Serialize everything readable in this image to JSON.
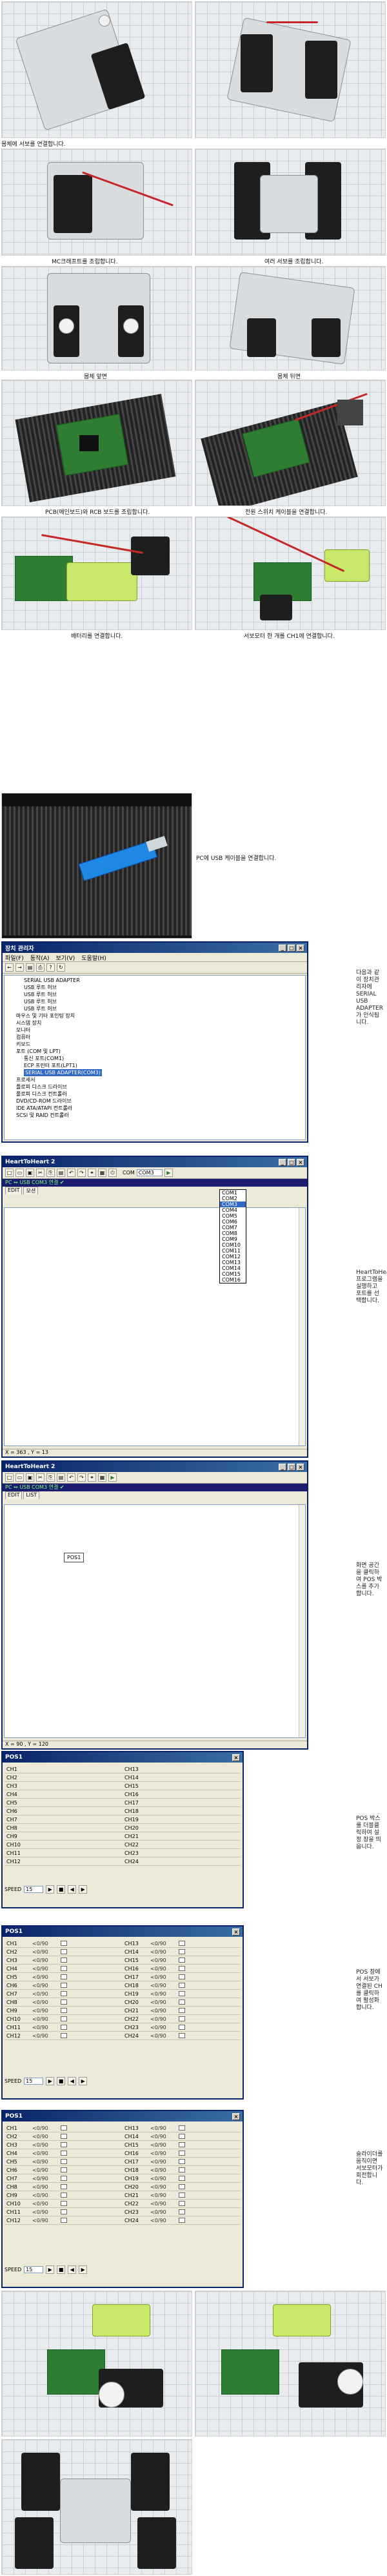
{
  "captions": {
    "p1": "몸체에 서보를 연결합니다.",
    "p2": "",
    "p3": "MC크래프트를 조립합니다.",
    "p4": "여러 서보를 조립합니다.",
    "p5": "몸체 앞면",
    "p6": "몸체 뒤면",
    "p7": "PCB(메인보드)와 RCB 보드를 조립합니다.",
    "p8": "전원 스위치 케이블을 연결합니다.",
    "p9": "배터리를 연결합니다.",
    "p10": "서보모터 한 개를 CH1에 연결합니다.",
    "p11": "PC에 USB 케이블을 연결합니다."
  },
  "device_manager": {
    "title": "장치 관리자",
    "menu": [
      "파일(F)",
      "동작(A)",
      "보기(V)",
      "도움말(H)"
    ],
    "tree": [
      "SERIAL USB ADAPTER",
      "USB 루트 허브",
      "USB 루트 허브",
      "USB 루트 허브",
      "USB 루트 허브",
      "마우스 및 기타 포인팅 장치",
      "시스템 장치",
      "모니터",
      "컴퓨터",
      "키보드",
      "포트 (COM 및 LPT)",
      "통신 포트(COM1)",
      "ECP 프린터 포트(LPT1)",
      "SERIAL USB ADAPTER(COM3)",
      "프로세서",
      "플로피 디스크 드라이브",
      "플로피 디스크 컨트롤러",
      "DVD/CD-ROM 드라이브",
      "IDE ATA/ATAPI 컨트롤러",
      "SCSI 및 RAID 컨트롤러"
    ],
    "selected_index": 13,
    "side_caption": "다음과 같이 장치관리자에 SERIAL USB ADAPTER가 인식됩니다."
  },
  "heart1": {
    "title": "HeartToHeart 2",
    "com_label": "COM",
    "com_value": "COM3",
    "com_options": [
      "COM1",
      "COM2",
      "COM3",
      "COM4",
      "COM5",
      "COM6",
      "COM7",
      "COM8",
      "COM9",
      "COM10",
      "COM11",
      "COM12",
      "COM13",
      "COM14",
      "COM15",
      "COM16"
    ],
    "status_line": "PC ↔ USB  COM3 연결 ✔",
    "tabs": [
      "EDIT",
      "모션"
    ],
    "statusbar": "X = 363 , Y = 13",
    "side_caption": "HeartToHeart 프로그램을 실행하고 포트를 선택합니다."
  },
  "heart2": {
    "title": "HeartToHeart 2",
    "status_line": "PC ↔ USB  COM3 연결 ✔",
    "tabs": [
      "EDIT",
      "LIST"
    ],
    "box_label": "POS1",
    "statusbar": "X = 90 , Y = 120",
    "side_caption": "화면 공간을 클릭하여 POS 박스를 추가합니다."
  },
  "pos_windows": [
    {
      "title": "POS1",
      "rows_left": [
        "CH1",
        "CH2",
        "CH3",
        "CH4",
        "CH5",
        "CH6",
        "CH7",
        "CH8",
        "CH9",
        "CH10",
        "CH11",
        "CH12"
      ],
      "rows_right": [
        "CH13",
        "CH14",
        "CH15",
        "CH16",
        "CH17",
        "CH18",
        "CH19",
        "CH20",
        "CH21",
        "CH22",
        "CH23",
        "CH24"
      ],
      "show_values": false,
      "speed_label": "SPEED",
      "speed_value": "15",
      "side_caption": "POS 박스를 더블클릭하여 설정 창을 띄웁니다."
    },
    {
      "title": "POS1",
      "rows_left": [
        "CH1",
        "CH2",
        "CH3",
        "CH4",
        "CH5",
        "CH6",
        "CH7",
        "CH8",
        "CH9",
        "CH10",
        "CH11",
        "CH12"
      ],
      "rows_right": [
        "CH13",
        "CH14",
        "CH15",
        "CH16",
        "CH17",
        "CH18",
        "CH19",
        "CH20",
        "CH21",
        "CH22",
        "CH23",
        "CH24"
      ],
      "show_values": true,
      "value_text": "<0/90",
      "speed_label": "SPEED",
      "speed_value": "15",
      "side_caption": "POS 창에서 서보가 연결된 CH 를 클릭하여 활성화합니다."
    },
    {
      "title": "POS1",
      "rows_left": [
        "CH1",
        "CH2",
        "CH3",
        "CH4",
        "CH5",
        "CH6",
        "CH7",
        "CH8",
        "CH9",
        "CH10",
        "CH11",
        "CH12"
      ],
      "rows_right": [
        "CH13",
        "CH14",
        "CH15",
        "CH16",
        "CH17",
        "CH18",
        "CH19",
        "CH20",
        "CH21",
        "CH22",
        "CH23",
        "CH24"
      ],
      "show_values": true,
      "value_text": "<0/90",
      "speed_label": "SPEED",
      "speed_value": "15",
      "side_caption": "슬라이더를 움직이면 서보모터가 회전합니다."
    }
  ],
  "colors": {
    "titlebar": "#0a246a",
    "window_bg": "#ece9d8",
    "pcb_green": "#2e7d32",
    "selection": "#316ac5"
  }
}
